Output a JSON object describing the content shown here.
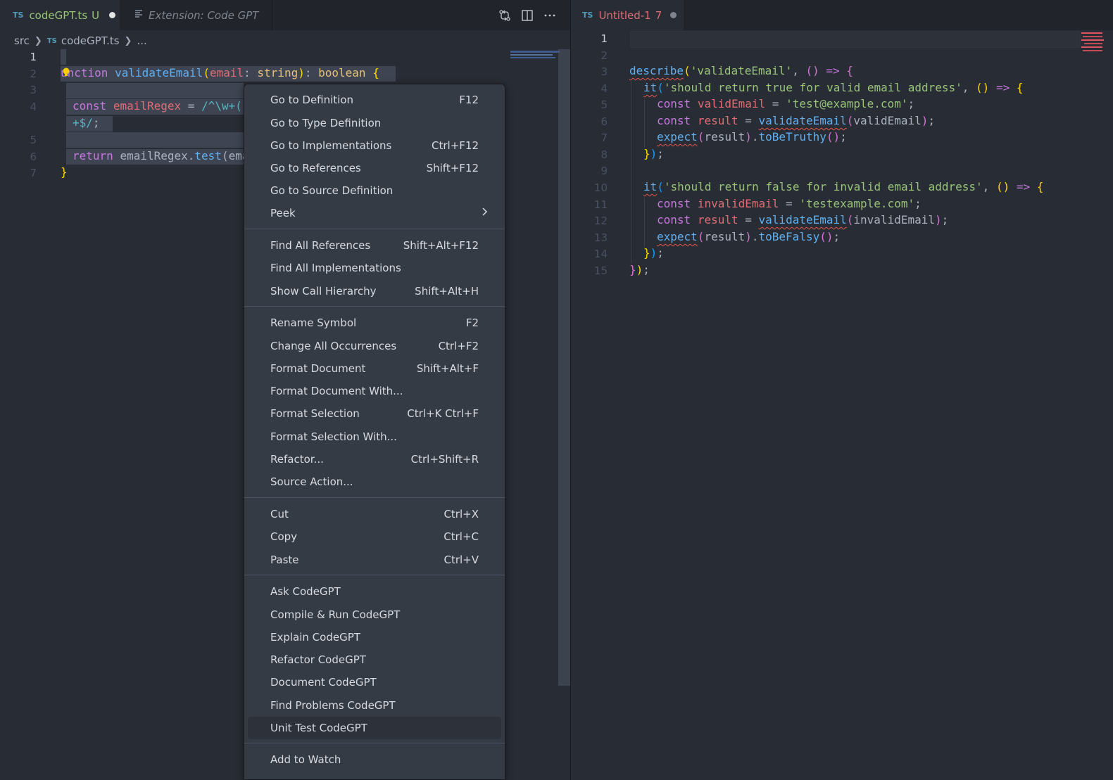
{
  "left_editor": {
    "tabs": [
      {
        "badge": "TS",
        "name": "codeGPT.ts",
        "status": "U"
      },
      {
        "icon": "preview-icon",
        "name": "Extension: Code GPT"
      }
    ],
    "breadcrumb": {
      "folder": "src",
      "badge": "TS",
      "file": "codeGPT.ts",
      "more": "..."
    },
    "line_numbers": [
      "1",
      "2",
      "3",
      "4",
      "5",
      "6",
      "7"
    ],
    "code": {
      "l2_kw": "unction",
      "l2_fn": "validateEmail",
      "l2_paren_open": "(",
      "l2_param": "email",
      "l2_colon": ":",
      "l2_type": "string",
      "l2_paren_close": ")",
      "l2_colon2": ":",
      "l2_ret": "boolean",
      "l2_brace": "{",
      "l4_kw": "const",
      "l4_var": "emailRegex",
      "l4_eq": "=",
      "l4_rx": "/^\\w+(",
      "l4b_rx": "+$/",
      "l4b_semi": ";",
      "l6_kw": "return",
      "l6_obj": "emailRegex.",
      "l6_fn": "test",
      "l6_rest": "(ema",
      "l7_brace": "}"
    }
  },
  "right_editor": {
    "tab": {
      "badge": "TS",
      "name": "Untitled-1",
      "problems": "7"
    },
    "line_numbers": [
      "1",
      "2",
      "3",
      "4",
      "5",
      "6",
      "7",
      "8",
      "9",
      "10",
      "11",
      "12",
      "13",
      "14",
      "15"
    ],
    "code": {
      "describe": "describe",
      "describe_str": "'validateEmail'",
      "comma": ",",
      "arrow": "=>",
      "it": "it",
      "it1_str": "'should return true for valid email address'",
      "it2_str": "'should return false for invalid email address'",
      "const": "const",
      "validEmail": "validEmail",
      "invalidEmail": "invalidEmail",
      "eq": "=",
      "valid_val": "'test@example.com'",
      "invalid_val": "'testexample.com'",
      "result": "result",
      "validateEmail": "validateEmail",
      "expect": "expect",
      "toBeTruthy": "toBeTruthy",
      "toBeFalsy": "toBeFalsy"
    }
  },
  "context_menu": {
    "groups": [
      [
        {
          "label": "Go to Definition",
          "shortcut": "F12"
        },
        {
          "label": "Go to Type Definition",
          "shortcut": ""
        },
        {
          "label": "Go to Implementations",
          "shortcut": "Ctrl+F12"
        },
        {
          "label": "Go to References",
          "shortcut": "Shift+F12"
        },
        {
          "label": "Go to Source Definition",
          "shortcut": ""
        },
        {
          "label": "Peek",
          "shortcut": ""
        }
      ],
      [
        {
          "label": "Find All References",
          "shortcut": "Shift+Alt+F12"
        },
        {
          "label": "Find All Implementations",
          "shortcut": ""
        },
        {
          "label": "Show Call Hierarchy",
          "shortcut": "Shift+Alt+H"
        }
      ],
      [
        {
          "label": "Rename Symbol",
          "shortcut": "F2"
        },
        {
          "label": "Change All Occurrences",
          "shortcut": "Ctrl+F2"
        },
        {
          "label": "Format Document",
          "shortcut": "Shift+Alt+F"
        },
        {
          "label": "Format Document With...",
          "shortcut": ""
        },
        {
          "label": "Format Selection",
          "shortcut": "Ctrl+K Ctrl+F"
        },
        {
          "label": "Format Selection With...",
          "shortcut": ""
        },
        {
          "label": "Refactor...",
          "shortcut": "Ctrl+Shift+R"
        },
        {
          "label": "Source Action...",
          "shortcut": ""
        }
      ],
      [
        {
          "label": "Cut",
          "shortcut": "Ctrl+X"
        },
        {
          "label": "Copy",
          "shortcut": "Ctrl+C"
        },
        {
          "label": "Paste",
          "shortcut": "Ctrl+V"
        }
      ],
      [
        {
          "label": "Ask CodeGPT",
          "shortcut": ""
        },
        {
          "label": "Compile & Run CodeGPT",
          "shortcut": ""
        },
        {
          "label": "Explain CodeGPT",
          "shortcut": ""
        },
        {
          "label": "Refactor CodeGPT",
          "shortcut": ""
        },
        {
          "label": "Document CodeGPT",
          "shortcut": ""
        },
        {
          "label": "Find Problems CodeGPT",
          "shortcut": ""
        },
        {
          "label": "Unit Test CodeGPT",
          "shortcut": ""
        }
      ],
      [
        {
          "label": "Add to Watch",
          "shortcut": ""
        }
      ]
    ],
    "hovered_item": "Unit Test CodeGPT"
  },
  "colors": {
    "editor_bg": "#282c34",
    "tabbar_bg": "#21252b",
    "menu_bg": "#353b45",
    "keyword": "#c678dd",
    "function": "#61afef",
    "string": "#98c379",
    "error": "#e06c75"
  }
}
